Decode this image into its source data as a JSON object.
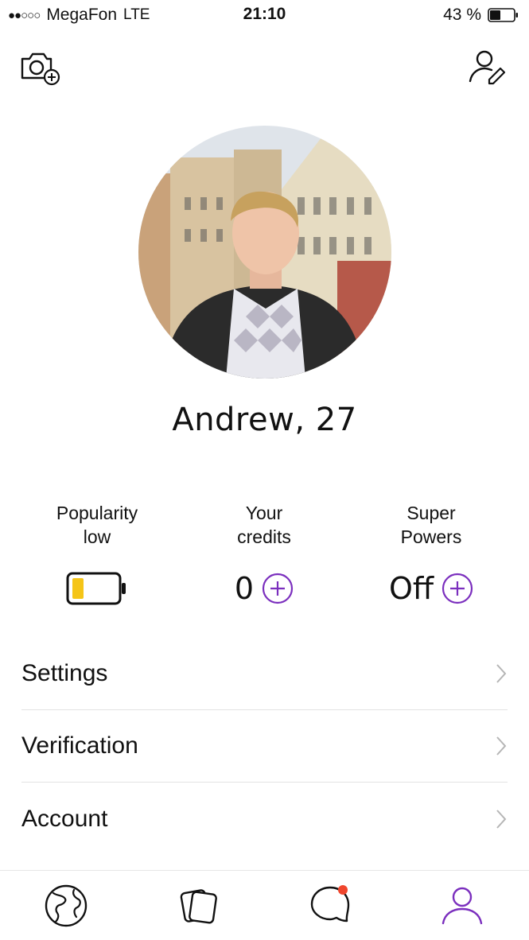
{
  "status_bar": {
    "signal": "●●○○○",
    "carrier": "MegaFon",
    "network": "LTE",
    "time": "21:10",
    "battery": "43 %"
  },
  "profile": {
    "name": "Andrew, 27"
  },
  "stats": {
    "popularity": {
      "line1": "Popularity",
      "line2": "low",
      "level": 0.25,
      "level_color": "#F5C518"
    },
    "credits": {
      "line1": "Your",
      "line2": "credits",
      "value": "0"
    },
    "super_powers": {
      "line1": "Super",
      "line2": "Powers",
      "value": "Off"
    }
  },
  "menu": {
    "items": [
      {
        "label": "Settings"
      },
      {
        "label": "Verification"
      },
      {
        "label": "Account"
      }
    ]
  },
  "tabs": [
    "globe-icon",
    "cards-icon",
    "chat-icon",
    "profile-icon"
  ],
  "colors": {
    "accent": "#7B2FBE",
    "notification": "#F0462D",
    "chevron": "#B5B5B5"
  }
}
